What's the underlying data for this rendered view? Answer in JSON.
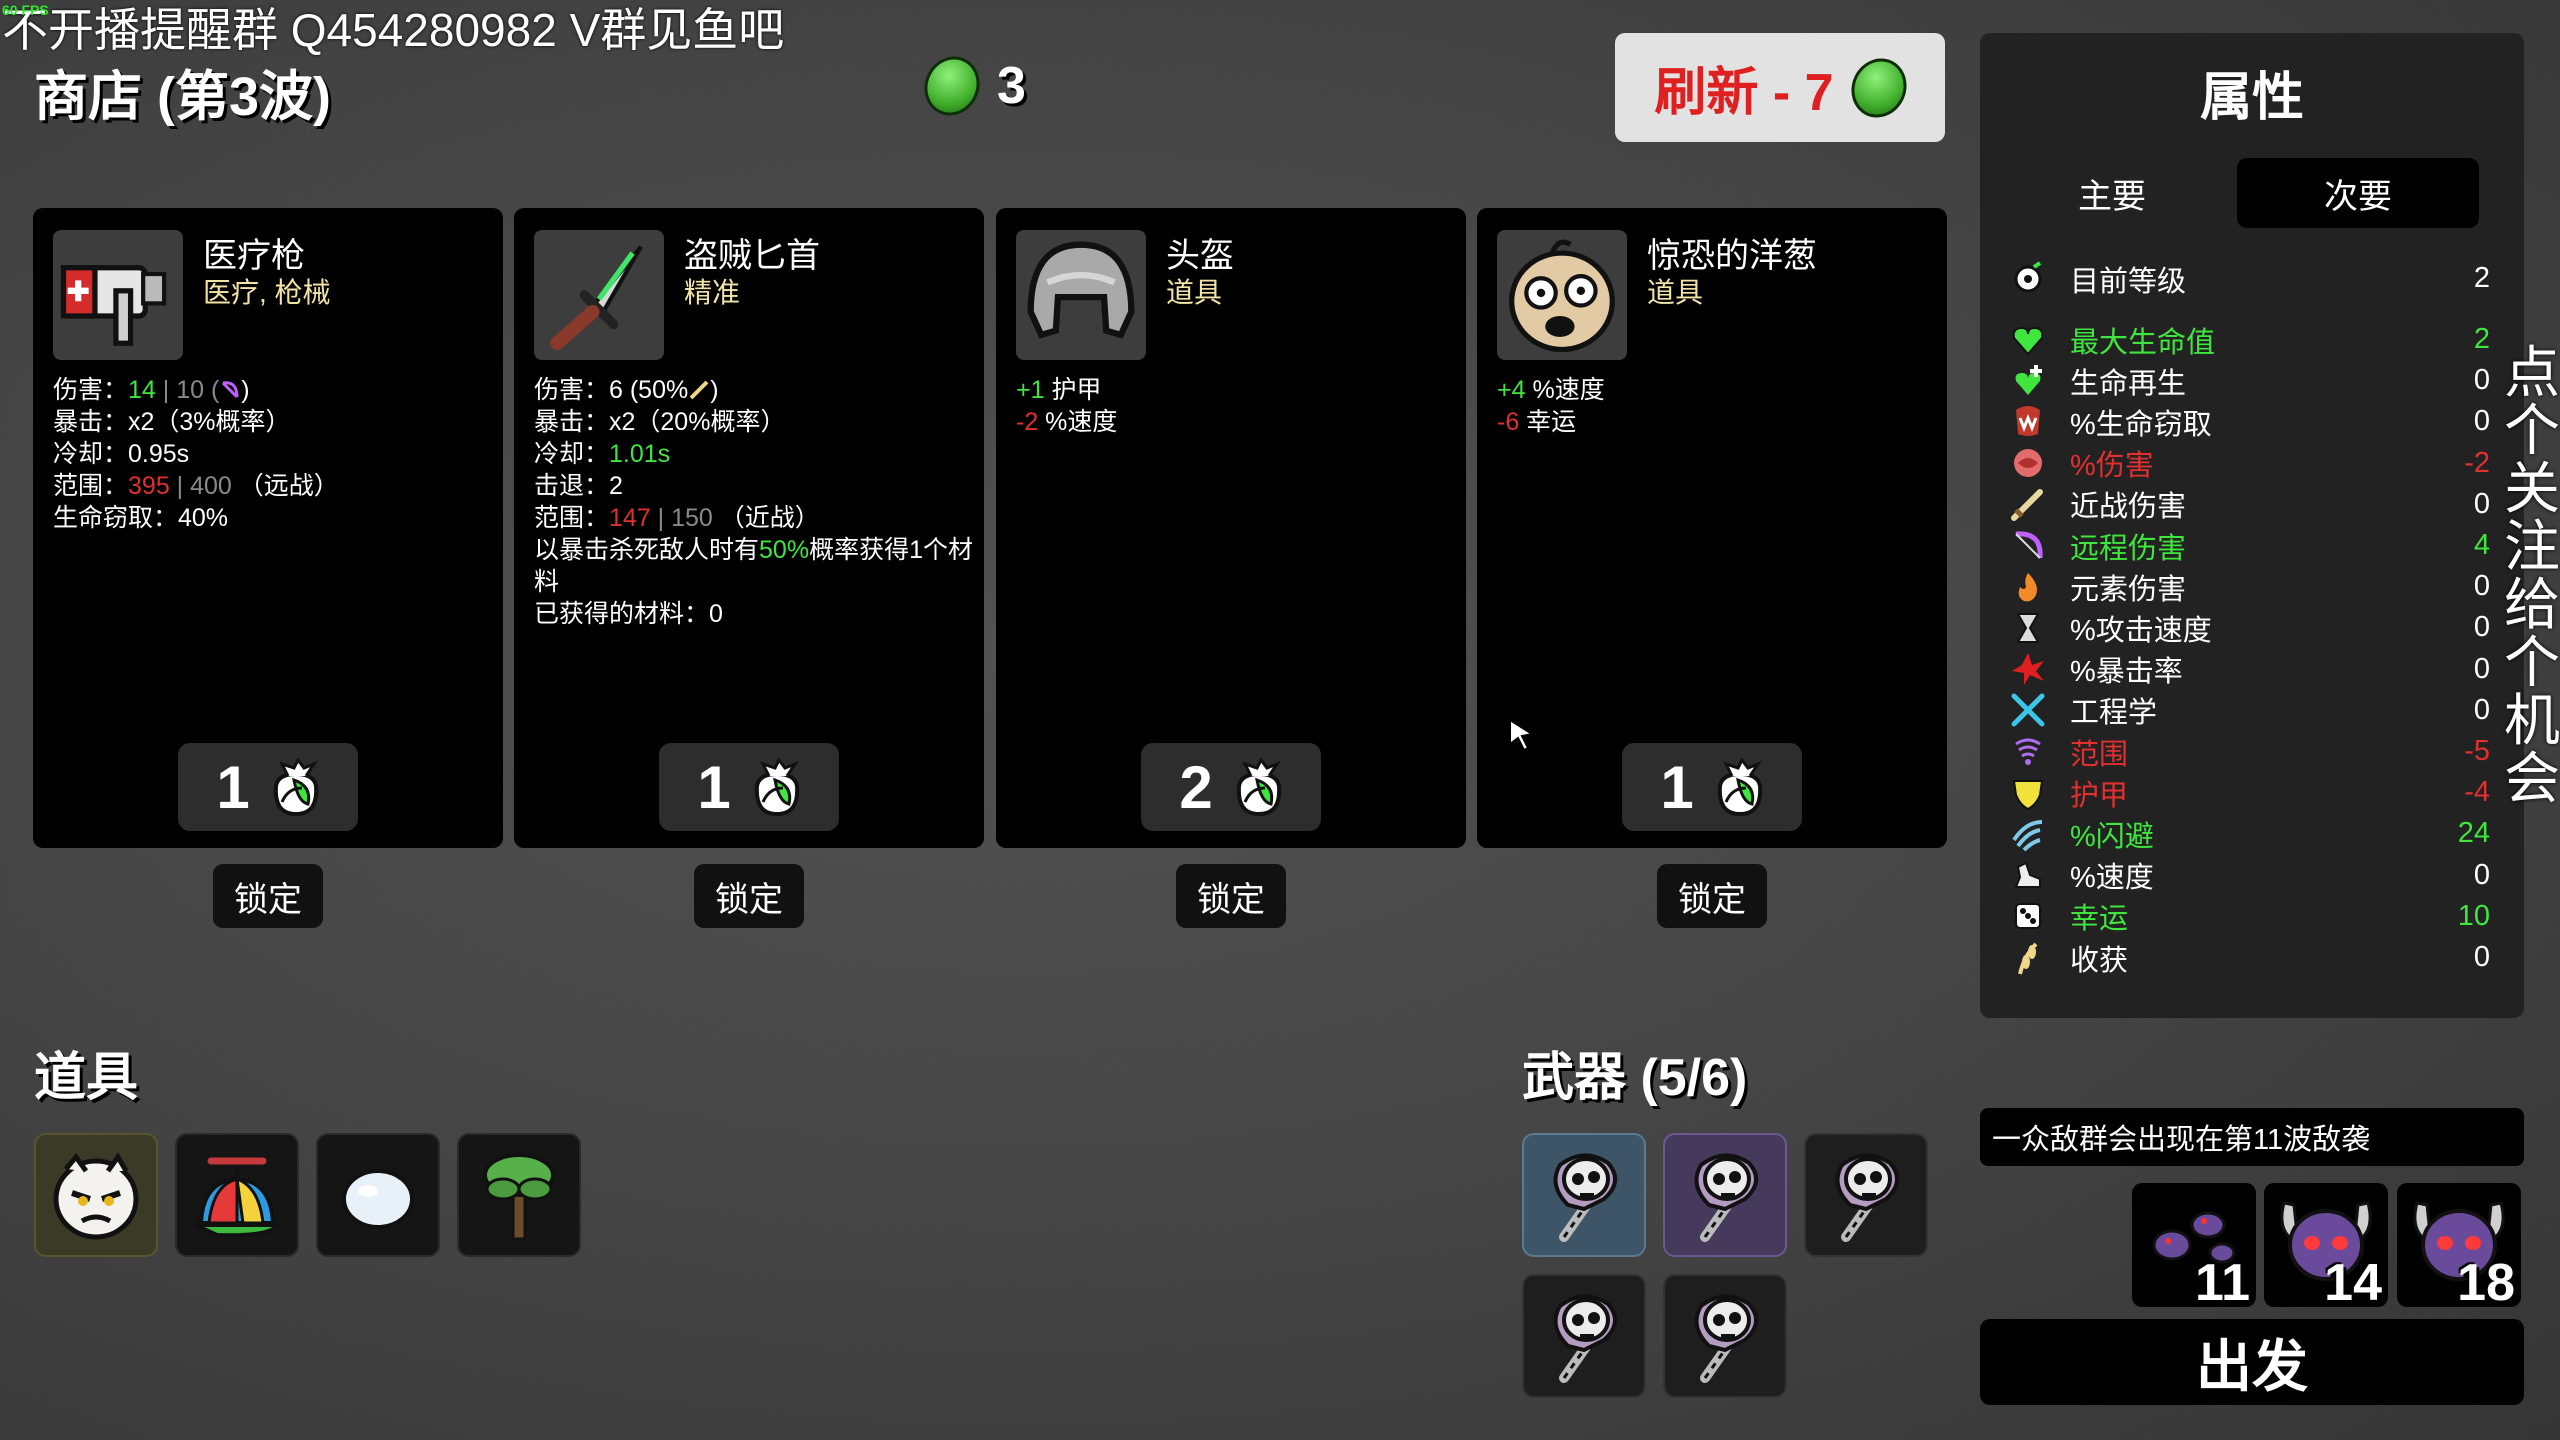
{
  "overlay_text": "不开播提醒群  Q454280982 V群见鱼吧",
  "fps_text": "60 FPS",
  "shop": {
    "title": "商店 (第3波)",
    "materials": "3",
    "reroll_label": "刷新 - 7"
  },
  "cards": [
    {
      "name": "医疗枪",
      "type": "医疗, 枪械",
      "icon": "medical-gun-icon",
      "stats": [
        [
          [
            "伤害：",
            ""
          ],
          [
            "14",
            "g"
          ],
          [
            " | 10 (",
            ""
          ],
          [
            "",
            "ranged-icon"
          ],
          [
            ")",
            ""
          ]
        ],
        [
          [
            "暴击：x2（3%概率）",
            ""
          ]
        ],
        [
          [
            "冷却：0.95s",
            ""
          ]
        ],
        [
          [
            "范围：",
            ""
          ],
          [
            "395",
            "r"
          ],
          [
            " | 400 （远战）",
            "mix"
          ]
        ],
        [
          [
            "生命窃取：40%",
            ""
          ]
        ]
      ],
      "price": "1",
      "lock_label": "锁定"
    },
    {
      "name": "盗贼匕首",
      "type": "精准",
      "icon": "dagger-icon",
      "stats": [
        [
          [
            "伤害：6 (50%",
            ""
          ],
          [
            "",
            "melee-icon"
          ],
          [
            ")",
            ""
          ]
        ],
        [
          [
            "暴击：x2（20%概率）",
            ""
          ]
        ],
        [
          [
            "冷却：",
            ""
          ],
          [
            "1.01s",
            "g"
          ]
        ],
        [
          [
            "击退：2",
            ""
          ]
        ],
        [
          [
            "范围：",
            ""
          ],
          [
            "147",
            "r"
          ],
          [
            " | 150 （近战）",
            "mix"
          ]
        ],
        [
          [
            "以暴击杀死敌人时有",
            ""
          ],
          [
            "50%",
            "g"
          ],
          [
            "概率获得1个材料",
            ""
          ]
        ],
        [
          [
            "已获得的材料：0",
            ""
          ]
        ]
      ],
      "price": "1",
      "lock_label": "锁定"
    },
    {
      "name": "头盔",
      "type": "道具",
      "icon": "helmet-icon",
      "stats": [
        [
          [
            "+1",
            "g"
          ],
          [
            " 护甲",
            ""
          ]
        ],
        [
          [
            "-2",
            "r"
          ],
          [
            " %速度",
            ""
          ]
        ]
      ],
      "price": "2",
      "lock_label": "锁定"
    },
    {
      "name": "惊恐的洋葱",
      "type": "道具",
      "icon": "scared-onion-icon",
      "stats": [
        [
          [
            "+4",
            "g"
          ],
          [
            " %速度",
            ""
          ]
        ],
        [
          [
            "-6",
            "r"
          ],
          [
            " 幸运",
            ""
          ]
        ]
      ],
      "price": "1",
      "lock_label": "锁定"
    }
  ],
  "items_section": {
    "title": "道具",
    "items": [
      "character-face-icon",
      "propeller-hat-icon",
      "egg-icon",
      "tree-icon"
    ]
  },
  "weapons_section": {
    "title": "武器 (5/6)",
    "count": 5
  },
  "stats_panel": {
    "title": "属性",
    "tab_primary": "主要",
    "tab_secondary": "次要",
    "rows": [
      {
        "icon": "level-icon",
        "label": "目前等级",
        "value": "2",
        "color": "#ffffff"
      },
      {
        "icon": "heart-icon",
        "label": "最大生命值",
        "value": "2",
        "color": "#3ee63e"
      },
      {
        "icon": "regen-icon",
        "label": "生命再生",
        "value": "0",
        "color": "#ffffff"
      },
      {
        "icon": "lifesteal-icon",
        "label": "%生命窃取",
        "value": "0",
        "color": "#ffffff"
      },
      {
        "icon": "damage-icon",
        "label": "%伤害",
        "value": "-2",
        "color": "#e03030"
      },
      {
        "icon": "melee-icon",
        "label": "近战伤害",
        "value": "0",
        "color": "#ffffff"
      },
      {
        "icon": "ranged-icon",
        "label": "远程伤害",
        "value": "4",
        "color": "#3ee63e"
      },
      {
        "icon": "elemental-icon",
        "label": "元素伤害",
        "value": "0",
        "color": "#ffffff"
      },
      {
        "icon": "attack-speed-icon",
        "label": "%攻击速度",
        "value": "0",
        "color": "#ffffff"
      },
      {
        "icon": "crit-icon",
        "label": "%暴击率",
        "value": "0",
        "color": "#ffffff"
      },
      {
        "icon": "engineering-icon",
        "label": "工程学",
        "value": "0",
        "color": "#ffffff"
      },
      {
        "icon": "range-icon",
        "label": "范围",
        "value": "-5",
        "color": "#e03030"
      },
      {
        "icon": "armor-icon",
        "label": "护甲",
        "value": "-4",
        "color": "#e03030"
      },
      {
        "icon": "dodge-icon",
        "label": "%闪避",
        "value": "24",
        "color": "#3ee63e"
      },
      {
        "icon": "speed-icon",
        "label": "%速度",
        "value": "0",
        "color": "#ffffff"
      },
      {
        "icon": "luck-icon",
        "label": "幸运",
        "value": "10",
        "color": "#3ee63e"
      },
      {
        "icon": "harvesting-icon",
        "label": "收获",
        "value": "0",
        "color": "#ffffff"
      }
    ]
  },
  "wave_notice": "一众敌群会出现在第11波敌袭",
  "enemy_waves": [
    {
      "icon": "bug-swarm-icon",
      "wave": "11"
    },
    {
      "icon": "horned-skull-icon",
      "wave": "14"
    },
    {
      "icon": "horned-skull-icon",
      "wave": "18"
    }
  ],
  "go_label": "出发",
  "side_text": "点个关注，给个机会"
}
